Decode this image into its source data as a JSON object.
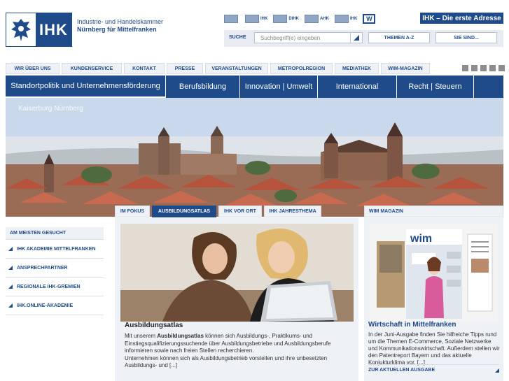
{
  "header": {
    "logo_text": "IHK",
    "org_line1": "Industrie- und Handelskammer",
    "org_line2": "Nürnberg für Mittelfranken",
    "slogan": "IHK – Die erste Adresse",
    "flags": [
      {
        "label": ""
      },
      {
        "label": "IHK"
      },
      {
        "label": "DIHK"
      },
      {
        "label": "AHK"
      },
      {
        "label": "IHK"
      }
    ],
    "wj_label": "W"
  },
  "search": {
    "label": "SUCHE",
    "placeholder": "Suchbegriff(e) eingeben",
    "themen_label": "THEMEN A-Z",
    "sie_sind_label": "SIE SIND..."
  },
  "service_nav": [
    "WIR ÜBER UNS",
    "KUNDENSERVICE",
    "KONTAKT",
    "PRESSE",
    "VERANSTALTUNGEN",
    "METROPOLREGION",
    "MEDIATHEK",
    "WIM-MAGAZIN"
  ],
  "main_nav": [
    "Standortpolitik und Unternehmensförderung",
    "Berufsbildung",
    "Innovation | Umwelt",
    "International",
    "Recht | Steuern"
  ],
  "hero": {
    "caption": "Kaiserburg Nürnberg"
  },
  "sidebar": {
    "heading": "AM MEISTEN GESUCHT",
    "items": [
      "IHK AKADEMIE MITTELFRANKEN",
      "ANSPRECHPARTNER",
      "REGIONALE IHK-GREMIEN",
      "IHK.ONLINE-AKADEMIE"
    ]
  },
  "teaser": {
    "tabs": [
      "IM FOKUS",
      "AUSBILDUNGSATLAS",
      "IHK VOR ORT",
      "IHK JAHRESTHEMA"
    ],
    "active_tab": 1,
    "title": "Ausbildungsatlas",
    "text_prefix": "Mit unserem ",
    "text_bold": "Ausbildungsatlas",
    "text_rest": " können sich Ausbildungs-, Praktikums- und Einstiegsqualifizierungssuchende über Ausbildungsbetriebe und Ausbildungsberufe informieren sowie nach freien Stellen recherchieren.",
    "text_second": "Unternehmen können sich als Ausbildungsbetrieb vorstellen und ihre unbesetzten Ausbildungs- und [...]"
  },
  "wim": {
    "heading": "WIM MAGAZIN",
    "cover_logo": "wim",
    "title": "Wirtschaft in Mittelfranken",
    "text": "In der Juni-Ausgabe finden Sie hilfreiche Tipps rund um die Themen E-Commerce, Soziale Netzwerke und Kommunikationswirtschaft. Außerdem stellen wir den Patentreport Bayern und das aktuelle Konjukturklima vor. [...]",
    "link": "ZUR AKTUELLEN AUSGABE"
  },
  "colors": {
    "brand_blue": "#1f4b8a",
    "light_panel": "#eef1f5"
  }
}
